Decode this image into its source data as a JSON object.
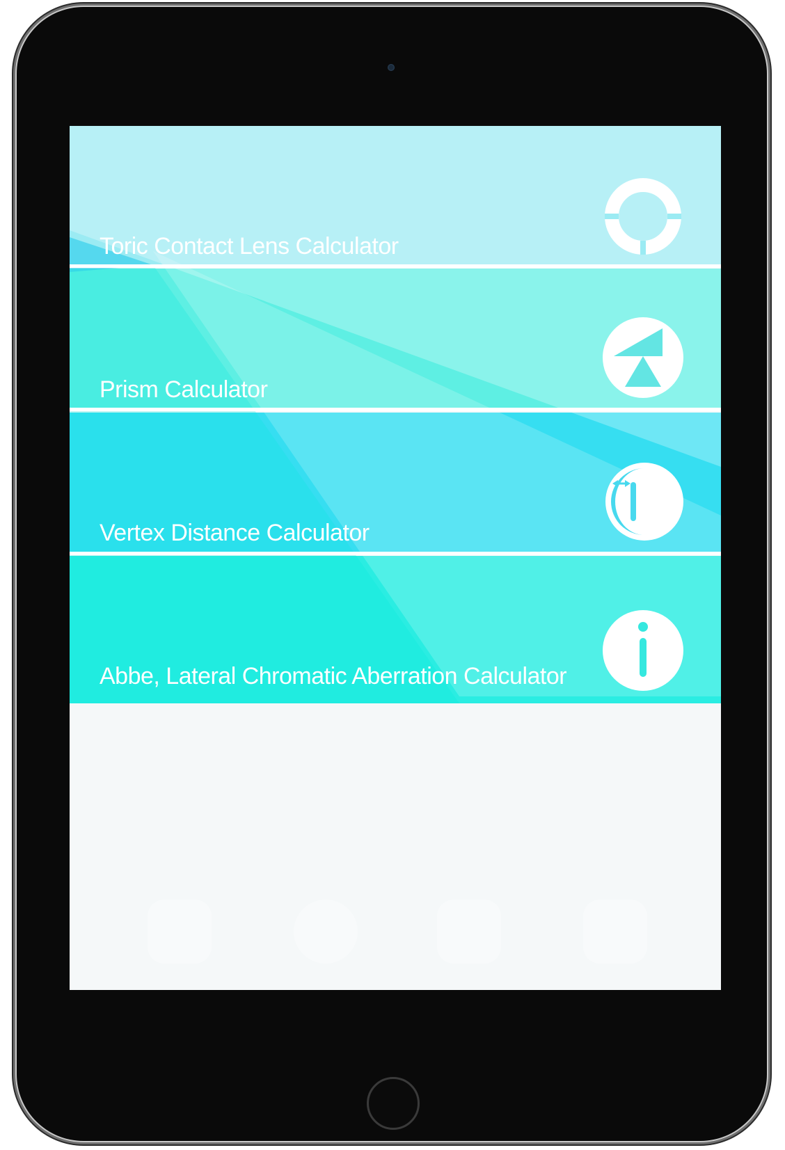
{
  "app": {
    "menu": [
      {
        "label": "Toric Contact Lens Calculator",
        "icon": "toric-lens-icon"
      },
      {
        "label": "Prism Calculator",
        "icon": "prism-icon"
      },
      {
        "label": "Vertex Distance Calculator",
        "icon": "eye-vertex-icon"
      },
      {
        "label": "Abbe, Lateral Chromatic Aberration Calculator",
        "icon": "info-icon"
      }
    ]
  },
  "colors": {
    "row1": "#9BEBF3",
    "row2": "#5EEFE3",
    "row3": "#36DEF1",
    "row4": "#2AEDE2",
    "screen_bg": "#F5F8F9",
    "device_body": "#0A0A0A"
  }
}
